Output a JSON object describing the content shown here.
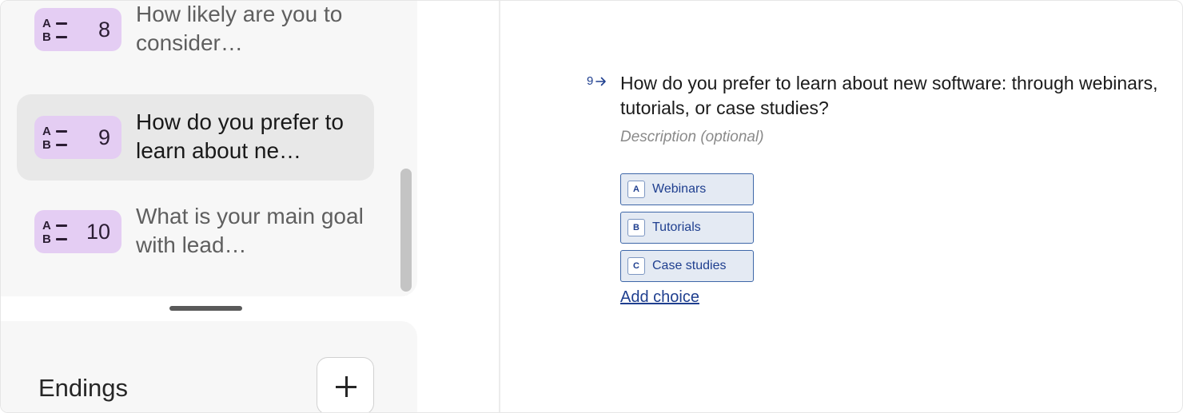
{
  "sidebar": {
    "questions": [
      {
        "badge_top": "A",
        "badge_bottom": "B",
        "number": "8",
        "text": "How likely are you to consider…",
        "active": false
      },
      {
        "badge_top": "A",
        "badge_bottom": "B",
        "number": "9",
        "text": "How do you prefer to learn about ne…",
        "active": true
      },
      {
        "badge_top": "A",
        "badge_bottom": "B",
        "number": "10",
        "text": "What is your main goal with lead…",
        "active": false
      }
    ],
    "endings": {
      "title": "Endings",
      "add_label": "+"
    }
  },
  "question": {
    "number": "9",
    "title": "How do you prefer to learn about new software: through webinars, tutorials, or case studies?",
    "description_placeholder": "Description (optional)",
    "choices": [
      {
        "key": "A",
        "label": "Webinars"
      },
      {
        "key": "B",
        "label": "Tutorials"
      },
      {
        "key": "C",
        "label": "Case studies"
      }
    ],
    "add_choice_label": "Add choice"
  },
  "colors": {
    "badge_bg": "#e4cdf3",
    "choice_bg": "#e4eaf3",
    "choice_border": "#3e67a8",
    "accent_text": "#1f3f8f"
  }
}
